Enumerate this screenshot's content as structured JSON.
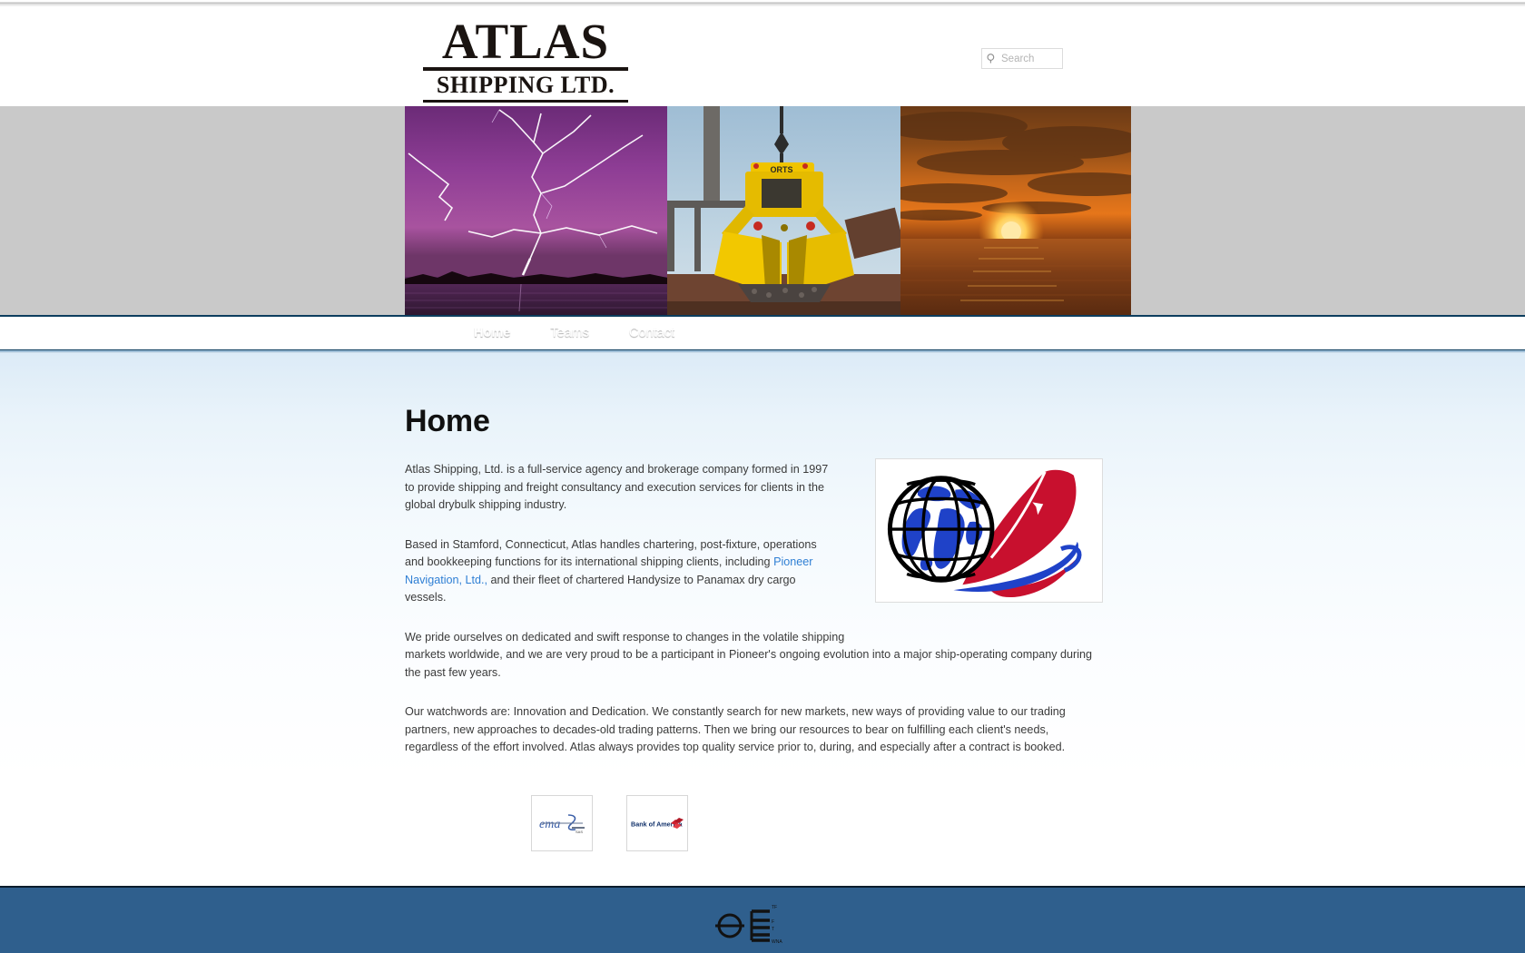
{
  "browser": {
    "chrome_strip": "scrollbar-strip"
  },
  "header": {
    "brand_main": "ATLAS",
    "brand_sub": "SHIPPING LTD.",
    "search": {
      "icon": "search-icon",
      "placeholder": "Search",
      "value": ""
    }
  },
  "banner": {
    "images": [
      {
        "name": "lightning-storm-over-water-photo",
        "alt": "Lightning storm over water"
      },
      {
        "name": "yellow-grab-bucket-photo",
        "alt": "Yellow ORTS grab bucket unloading drybulk cargo",
        "label": "ORTS"
      },
      {
        "name": "ocean-sunset-photo",
        "alt": "Sunset over the ocean"
      }
    ]
  },
  "nav": {
    "items": [
      {
        "label": "Home",
        "active": true
      },
      {
        "label": "Teams",
        "active": false
      },
      {
        "label": "Contact",
        "active": false
      }
    ]
  },
  "main": {
    "title": "Home",
    "paragraphs": {
      "p1": "Atlas Shipping, Ltd. is a full-service agency and brokerage company formed in 1997 to provide shipping and freight consultancy and execution services for clients in the global drybulk shipping industry.",
      "p2_before_link": "Based in Stamford, Connecticut, Atlas handles chartering, post-fixture, operations and bookkeeping functions for its international shipping clients, including ",
      "p2_link": "Pioneer Navigation, Ltd.,",
      "p2_after_link": " and their fleet of chartered Handysize to Panamax dry cargo vessels.",
      "p3_line1": "We pride ourselves on dedicated and swift response to changes in the volatile shipping",
      "p3_line2": "markets worldwide, and  we are very proud to be a  participant in Pioneer's ongoing evolution into a major ship-operating company during the past few years.",
      "p4": "Our watchwords are:  Innovation and Dedication. We constantly search for new markets,  new ways of providing value to our trading partners, new approaches to  decades-old trading patterns.  Then we bring our resources to bear on fulfilling each client's needs, regardless of the effort involved.  Atlas always provides top quality service  prior to, during, and especially after a contract is booked."
    },
    "hero_logo": {
      "name": "globe-swoosh-logo",
      "alt": "Globe with red and blue swoosh logo"
    },
    "partners": [
      {
        "name": "ema-script-logo",
        "label": "ema"
      },
      {
        "name": "bank-of-america-logo",
        "label": "Bank of America"
      }
    ]
  },
  "footer": {
    "mark": {
      "name": "plimsoll-load-line-mark",
      "alt": "Plimsoll load line marking"
    }
  },
  "colors": {
    "nav_blue": "#0f6598",
    "footer_blue": "#2f5f8d",
    "link_blue": "#2f7fd4",
    "banner_grey": "#c9c9c9",
    "content_top": "#dcebf7"
  }
}
